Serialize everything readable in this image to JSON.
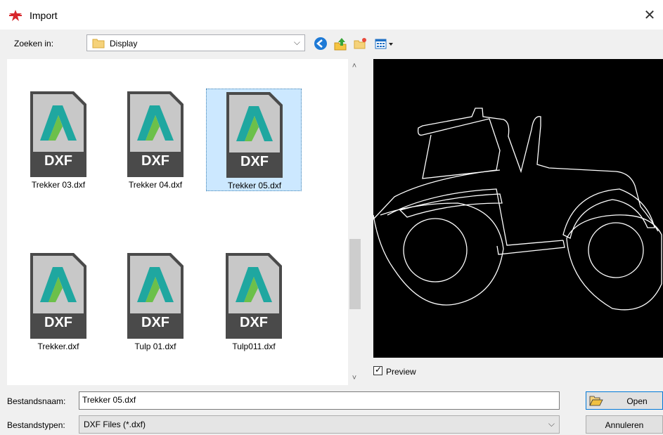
{
  "window": {
    "title": "Import",
    "close_glyph": "✕"
  },
  "toolbar": {
    "lookin_label": "Zoeken in:",
    "lookin_value": "Display",
    "chevron": "⌵",
    "icons": [
      "back-icon",
      "up-folder-icon",
      "new-folder-icon",
      "view-menu-icon"
    ]
  },
  "files": [
    {
      "name": "Trekker 03.dxf",
      "badge": "DXF",
      "selected": false
    },
    {
      "name": "Trekker 04.dxf",
      "badge": "DXF",
      "selected": false
    },
    {
      "name": "Trekker 05.dxf",
      "badge": "DXF",
      "selected": true
    },
    {
      "name": "Trekker.dxf",
      "badge": "DXF",
      "selected": false
    },
    {
      "name": "Tulp 01.dxf",
      "badge": "DXF",
      "selected": false
    },
    {
      "name": "Tulp011.dxf",
      "badge": "DXF",
      "selected": false
    }
  ],
  "scroll": {
    "up_glyph": "˄",
    "down_glyph": "˅"
  },
  "preview": {
    "checkbox_label": "Preview",
    "checked": true,
    "check_glyph": "✓"
  },
  "footer": {
    "filename_label": "Bestandsnaam:",
    "filename_value": "Trekker 05.dxf",
    "filetype_label": "Bestandstypen:",
    "filetype_value": "DXF Files (*.dxf)",
    "open_label": "Open",
    "cancel_label": "Annuleren"
  },
  "colors": {
    "app_icon_red": "#d7262b",
    "selection": "#cce8ff",
    "accent": "#0078d7"
  }
}
